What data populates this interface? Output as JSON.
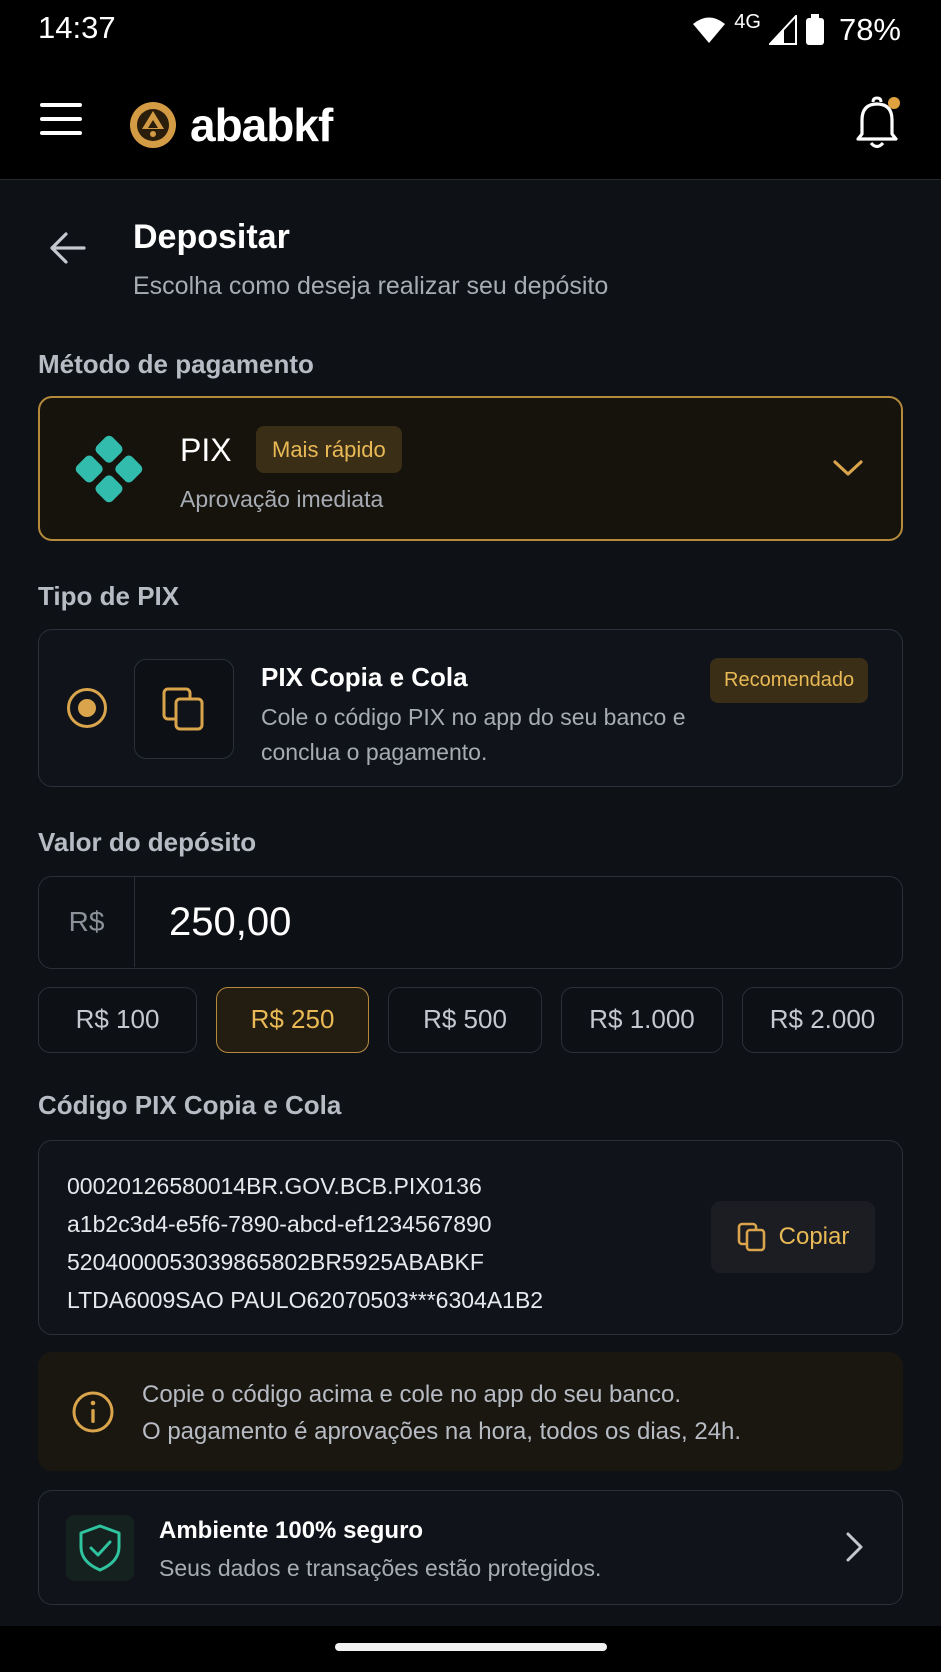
{
  "status_bar": {
    "time": "14:37",
    "network": "4G",
    "battery": "78%"
  },
  "header": {
    "app_name": "ababkf",
    "notification_dot": true
  },
  "page": {
    "title": "Depositar",
    "subtitle": "Escolha como deseja realizar seu depósito"
  },
  "payment_method": {
    "label": "Método de pagamento",
    "name": "PIX",
    "badge": "Mais rápido",
    "description": "Aprovação imediata"
  },
  "pix_type": {
    "label": "Tipo de PIX",
    "selected": true,
    "title": "PIX Copia e Cola",
    "description": "Cole o código PIX no app do seu banco e conclua o pagamento.",
    "badge": "Recomendado"
  },
  "amount": {
    "label": "Valor do depósito",
    "currency": "R$",
    "value": "250,00",
    "quick_options": [
      "R$ 100",
      "R$ 250",
      "R$ 500",
      "R$ 1.000",
      "R$ 2.000"
    ],
    "selected_option": "R$ 250"
  },
  "pix_code": {
    "label": "Código PIX Copia e Cola",
    "lines": [
      "00020126580014BR.GOV.BCB.PIX0136",
      "a1b2c3d4-e5f6-7890-abcd-ef1234567890",
      "5204000053039865802BR5925ABABKF",
      "LTDA6009SAO PAULO62070503***6304A1B2"
    ],
    "copy_label": "Copiar"
  },
  "info": {
    "line1": "Copie o código acima e cole no app do seu banco.",
    "line2": "O pagamento é aprovações na hora, todos os dias, 24h."
  },
  "security": {
    "title": "Ambiente 100% seguro",
    "subtitle": "Seus dados e transações estão protegidos."
  },
  "colors": {
    "accent": "#d9a44b",
    "accent_text": "#e9b955",
    "background": "#0e1116",
    "pix_teal": "#32bcad",
    "shield_green": "#2fc3a0"
  },
  "icons": [
    "menu-icon",
    "logo-icon",
    "bell-icon",
    "back-arrow-icon",
    "pix-icon",
    "chevron-down-icon",
    "copy-icon",
    "info-icon",
    "shield-check-icon",
    "chevron-right-icon",
    "wifi-icon",
    "signal-icon",
    "battery-icon"
  ]
}
